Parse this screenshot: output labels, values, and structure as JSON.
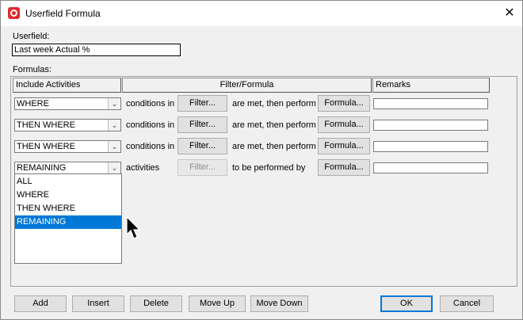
{
  "window": {
    "title": "Userfield Formula",
    "close_glyph": "✕",
    "app_icon": "app-logo-icon"
  },
  "userfield": {
    "label": "Userfield:",
    "value": "Last week Actual %"
  },
  "formulas": {
    "label": "Formulas:",
    "columns": [
      "Include Activities",
      "Filter/Formula",
      "Remarks"
    ],
    "rows": [
      {
        "selector": "WHERE",
        "text1": "conditions in",
        "filter_button": "Filter...",
        "text2": "are met, then perform",
        "formula_button": "Formula...",
        "remarks": ""
      },
      {
        "selector": "THEN WHERE",
        "text1": "conditions in",
        "filter_button": "Filter...",
        "text2": "are met, then perform",
        "formula_button": "Formula...",
        "remarks": ""
      },
      {
        "selector": "THEN WHERE",
        "text1": "conditions in",
        "filter_button": "Filter...",
        "text2": "are met, then perform",
        "formula_button": "Formula...",
        "remarks": ""
      },
      {
        "selector": "REMAINING",
        "text1": "activities",
        "filter_button": "Filter...",
        "text2": "to be performed by",
        "formula_button": "Formula...",
        "remarks": "",
        "filter_disabled": true
      }
    ],
    "dropdown": {
      "options": [
        "ALL",
        "WHERE",
        "THEN WHERE",
        "REMAINING"
      ],
      "selected": "REMAINING"
    }
  },
  "buttons": {
    "add": "Add",
    "insert": "Insert",
    "delete": "Delete",
    "move_up": "Move Up",
    "move_down": "Move Down",
    "ok": "OK",
    "cancel": "Cancel"
  },
  "colors": {
    "selection": "#0078d7",
    "app_icon": "#e0292f"
  }
}
